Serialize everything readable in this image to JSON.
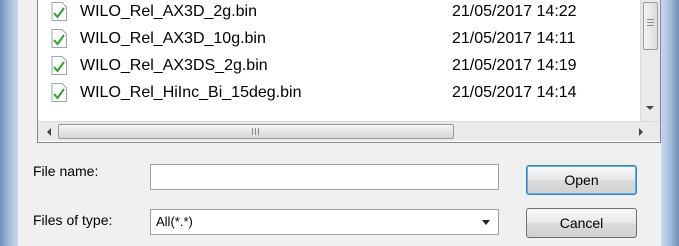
{
  "files": [
    {
      "name": "WILO_Rel_AX3D_2g.bin",
      "date": "21/05/2017 14:22",
      "icon": "green-checkmark-file-icon"
    },
    {
      "name": "WILO_Rel_AX3D_10g.bin",
      "date": "21/05/2017 14:11",
      "icon": "green-checkmark-file-icon"
    },
    {
      "name": "WILO_Rel_AX3DS_2g.bin",
      "date": "21/05/2017 14:19",
      "icon": "green-checkmark-file-icon"
    },
    {
      "name": "WILO_Rel_HiInc_Bi_15deg.bin",
      "date": "21/05/2017 14:14",
      "icon": "green-checkmark-file-icon"
    }
  ],
  "file_name": {
    "label": "File name:",
    "value": ""
  },
  "files_of_type": {
    "label": "Files of type:",
    "selected": "All(*.*)"
  },
  "buttons": {
    "open": "Open",
    "cancel": "Cancel"
  }
}
